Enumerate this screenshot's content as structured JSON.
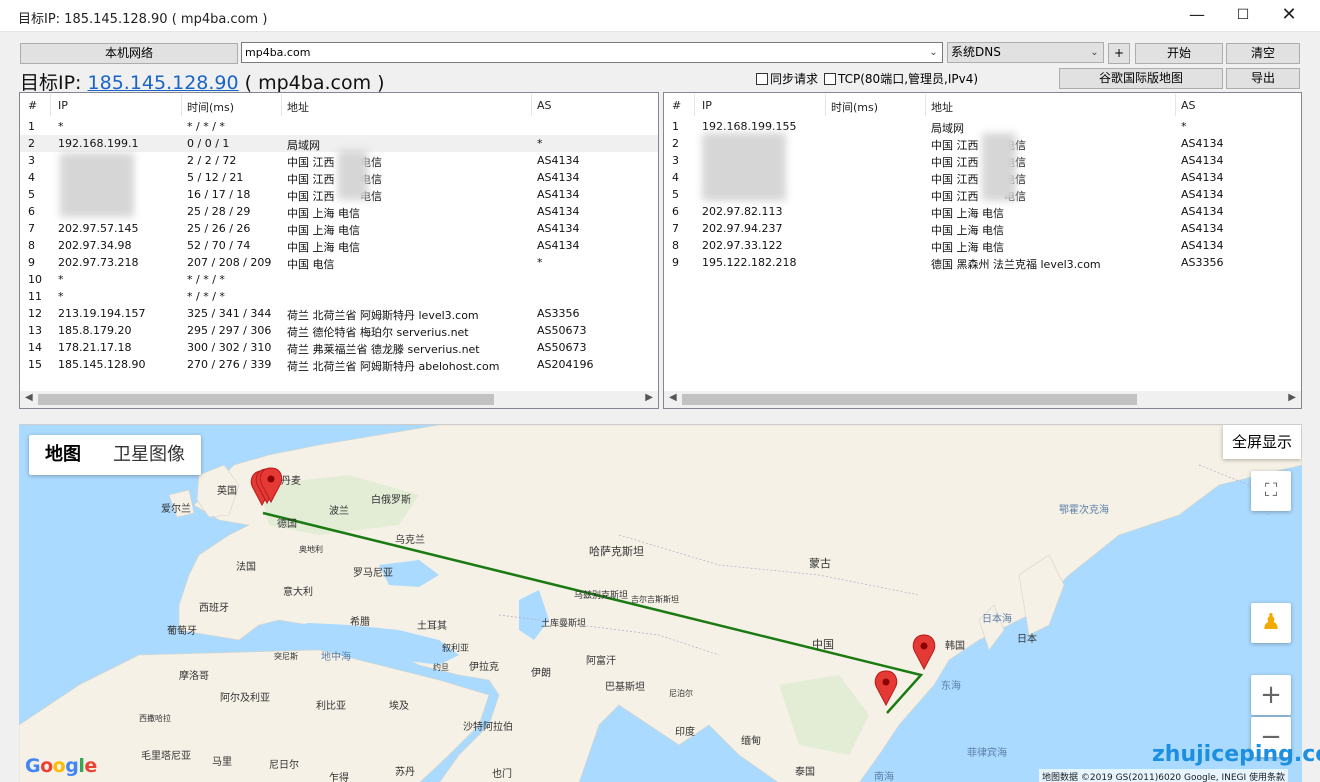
{
  "window": {
    "title": "目标IP: 185.145.128.90 ( mp4ba.com )"
  },
  "toolbar": {
    "local_network_btn": "本机网络",
    "host_value": "mp4ba.com",
    "dns_value": "系统DNS",
    "plus_btn": "+",
    "start_btn": "开始",
    "clear_btn": "清空",
    "google_map_btn": "谷歌国际版地图",
    "export_btn": "导出",
    "sync_label": "同步请求",
    "tcp_label": "TCP(80端口,管理员,IPv4)"
  },
  "target": {
    "prefix": "目标IP: ",
    "ip": "185.145.128.90",
    "host": " ( mp4ba.com )"
  },
  "columns": {
    "num": "#",
    "ip": "IP",
    "time": "时间(ms)",
    "addr": "地址",
    "as": "AS"
  },
  "left_table": [
    {
      "n": "1",
      "ip": "*",
      "t": "* / * / *",
      "addr": "",
      "as": ""
    },
    {
      "n": "2",
      "ip": "192.168.199.1",
      "t": "0 / 0 / 1",
      "addr": "局域网",
      "as": "*"
    },
    {
      "n": "3",
      "ip": "",
      "t": "2 / 2 / 72",
      "addr": "中国 江西 　　电信",
      "as": "AS4134"
    },
    {
      "n": "4",
      "ip": "",
      "t": "5 / 12 / 21",
      "addr": "中国 江西 　　电信",
      "as": "AS4134"
    },
    {
      "n": "5",
      "ip": "",
      "t": "16 / 17 / 18",
      "addr": "中国 江西 　　电信",
      "as": "AS4134"
    },
    {
      "n": "6",
      "ip": "",
      "t": "25 / 28 / 29",
      "addr": "中国 上海 电信",
      "as": "AS4134"
    },
    {
      "n": "7",
      "ip": "202.97.57.145",
      "t": "25 / 26 / 26",
      "addr": "中国 上海 电信",
      "as": "AS4134"
    },
    {
      "n": "8",
      "ip": "202.97.34.98",
      "t": "52 / 70 / 74",
      "addr": "中国 上海 电信",
      "as": "AS4134"
    },
    {
      "n": "9",
      "ip": "202.97.73.218",
      "t": "207 / 208 / 209",
      "addr": "中国 电信",
      "as": "*"
    },
    {
      "n": "10",
      "ip": "*",
      "t": "* / * / *",
      "addr": "",
      "as": ""
    },
    {
      "n": "11",
      "ip": "*",
      "t": "* / * / *",
      "addr": "",
      "as": ""
    },
    {
      "n": "12",
      "ip": "213.19.194.157",
      "t": "325 / 341 / 344",
      "addr": "荷兰 北荷兰省 阿姆斯特丹 level3.com",
      "as": "AS3356"
    },
    {
      "n": "13",
      "ip": "185.8.179.20",
      "t": "295 / 297 / 306",
      "addr": "荷兰 德伦特省 梅珀尔 serverius.net",
      "as": "AS50673"
    },
    {
      "n": "14",
      "ip": "178.21.17.18",
      "t": "300 / 302 / 310",
      "addr": "荷兰 弗莱福兰省 德龙滕 serverius.net",
      "as": "AS50673"
    },
    {
      "n": "15",
      "ip": "185.145.128.90",
      "t": "270 / 276 / 339",
      "addr": "荷兰 北荷兰省 阿姆斯特丹 abelohost.com",
      "as": "AS204196"
    }
  ],
  "right_table": [
    {
      "n": "1",
      "ip": "192.168.199.155",
      "t": "",
      "addr": "局域网",
      "as": "*"
    },
    {
      "n": "2",
      "ip": "",
      "t": "",
      "addr": "中国 江西 　　电信",
      "as": "AS4134"
    },
    {
      "n": "3",
      "ip": "",
      "t": "",
      "addr": "中国 江西 　　电信",
      "as": "AS4134"
    },
    {
      "n": "4",
      "ip": "",
      "t": "",
      "addr": "中国 江西 　　电信",
      "as": "AS4134"
    },
    {
      "n": "5",
      "ip": "",
      "t": "",
      "addr": "中国 江西 　　电信",
      "as": "AS4134"
    },
    {
      "n": "6",
      "ip": "202.97.82.113",
      "t": "",
      "addr": "中国 上海 电信",
      "as": "AS4134"
    },
    {
      "n": "7",
      "ip": "202.97.94.237",
      "t": "",
      "addr": "中国 上海 电信",
      "as": "AS4134"
    },
    {
      "n": "8",
      "ip": "202.97.33.122",
      "t": "",
      "addr": "中国 上海 电信",
      "as": "AS4134"
    },
    {
      "n": "9",
      "ip": "195.122.182.218",
      "t": "",
      "addr": "德国 黑森州 法兰克福 level3.com",
      "as": "AS3356"
    }
  ],
  "map": {
    "tab_map": "地图",
    "tab_satellite": "卫星图像",
    "fullscreen_btn": "全屏显示",
    "zoom_in": "+",
    "zoom_out": "−",
    "fullscreen_icon": "⛶",
    "pegman": "♟",
    "google": "Google",
    "attribution": "地图数据 ©2019 GS(2011)6020 Google, INEGI   使用条款",
    "labels": {
      "uk": "英国",
      "ireland": "爱尔兰",
      "denmark": "丹麦",
      "germany": "德国",
      "poland": "波兰",
      "belarus": "白俄罗斯",
      "ukraine": "乌克兰",
      "austria": "奥地利",
      "france": "法国",
      "romania": "罗马尼亚",
      "italy": "意大利",
      "spain": "西班牙",
      "portugal": "葡萄牙",
      "greece": "希腊",
      "turkey": "土耳其",
      "mediterranean": "地中海",
      "tunisia": "突尼斯",
      "morocco": "摩洛哥",
      "algeria": "阿尔及利亚",
      "libya": "利比亚",
      "egypt": "埃及",
      "west_sahara": "西撒哈拉",
      "mauritania": "毛里塔尼亚",
      "mali": "马里",
      "niger": "尼日尔",
      "chad": "乍得",
      "sudan": "苏丹",
      "kazakhstan": "哈萨克斯坦",
      "mongolia": "蒙古",
      "uzbekistan": "乌兹别克斯坦",
      "kyrgyzstan": "吉尔吉斯斯坦",
      "turkmenistan": "土库曼斯坦",
      "syria": "叙利亚",
      "iraq": "伊拉克",
      "iran": "伊朗",
      "jordan": "约旦",
      "afghanistan": "阿富汗",
      "pakistan": "巴基斯坦",
      "saudi": "沙特阿拉伯",
      "yemen": "也门",
      "nepal": "尼泊尔",
      "india": "印度",
      "myanmar": "缅甸",
      "thailand": "泰国",
      "china": "中国",
      "korea": "韩国",
      "japan": "日本",
      "sea_japan": "日本海",
      "east_sea": "东海",
      "philippine_sea": "菲律宾海",
      "south_sea": "南海",
      "okhotsk": "鄂霍次克海"
    }
  },
  "watermark": "zhujiceping.com"
}
